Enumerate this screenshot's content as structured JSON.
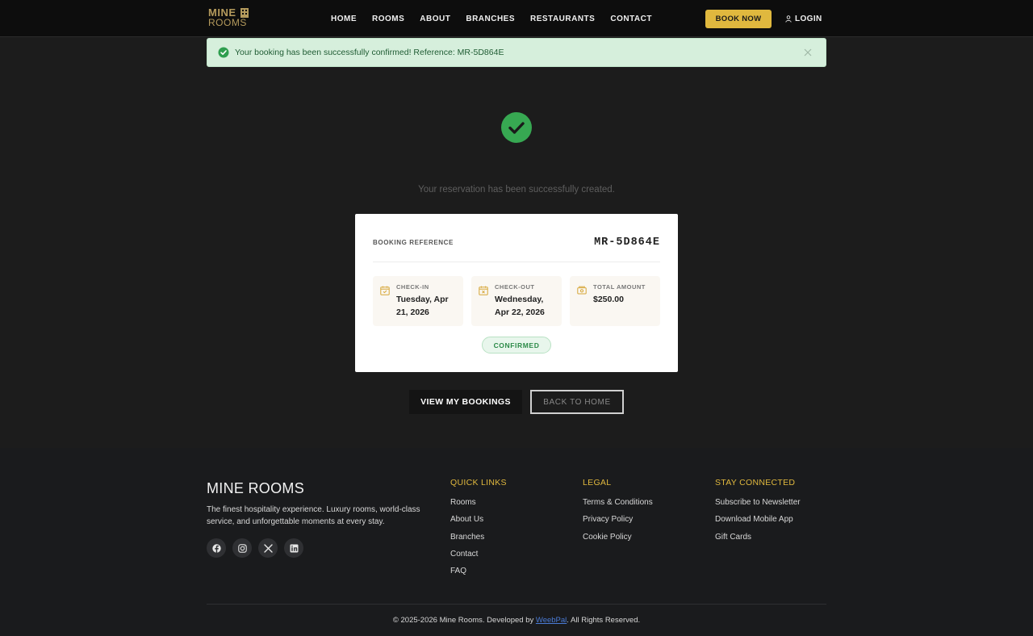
{
  "header": {
    "logo_line1": "MINE",
    "logo_line2": "ROOMS",
    "nav": [
      "HOME",
      "ROOMS",
      "ABOUT",
      "BRANCHES",
      "RESTAURANTS",
      "CONTACT"
    ],
    "book_label": "BOOK NOW",
    "login_label": "LOGIN"
  },
  "alert": {
    "message": "Your booking has been successfully confirmed! Reference: MR-5D864E"
  },
  "main": {
    "subtitle": "Your reservation has been successfully created.",
    "card": {
      "ref_label": "BOOKING REFERENCE",
      "ref_value": "MR-5D864E",
      "tiles": [
        {
          "label": "CHECK-IN",
          "value": "Tuesday, Apr 21, 2026",
          "icon": "calendar-check-icon"
        },
        {
          "label": "CHECK-OUT",
          "value": "Wednesday, Apr 22, 2026",
          "icon": "calendar-x-icon"
        },
        {
          "label": "TOTAL AMOUNT",
          "value": "$250.00",
          "icon": "cash-icon"
        }
      ],
      "status": "CONFIRMED"
    },
    "primary_button": "VIEW MY BOOKINGS",
    "secondary_button": "BACK TO HOME"
  },
  "footer": {
    "brand": "MINE ROOMS",
    "description": "The finest hospitality experience. Luxury rooms, world-class service, and unforgettable moments at every stay.",
    "socials": [
      "facebook-icon",
      "instagram-icon",
      "x-icon",
      "linkedin-icon"
    ],
    "columns": [
      {
        "heading": "QUICK LINKS",
        "links": [
          "Rooms",
          "About Us",
          "Branches",
          "Contact",
          "FAQ"
        ]
      },
      {
        "heading": "LEGAL",
        "links": [
          "Terms & Conditions",
          "Privacy Policy",
          "Cookie Policy"
        ]
      },
      {
        "heading": "STAY CONNECTED",
        "links": [
          "Subscribe to Newsletter",
          "Download Mobile App",
          "Gift Cards"
        ]
      }
    ],
    "copyright_pre": "© 2025-2026 Mine Rooms. Developed by ",
    "developer": "WeebPal",
    "copyright_post": ". All Rights Reserved."
  },
  "colors": {
    "accent": "#e0b83e",
    "success": "#34a853",
    "background": "#1c1c1c"
  }
}
